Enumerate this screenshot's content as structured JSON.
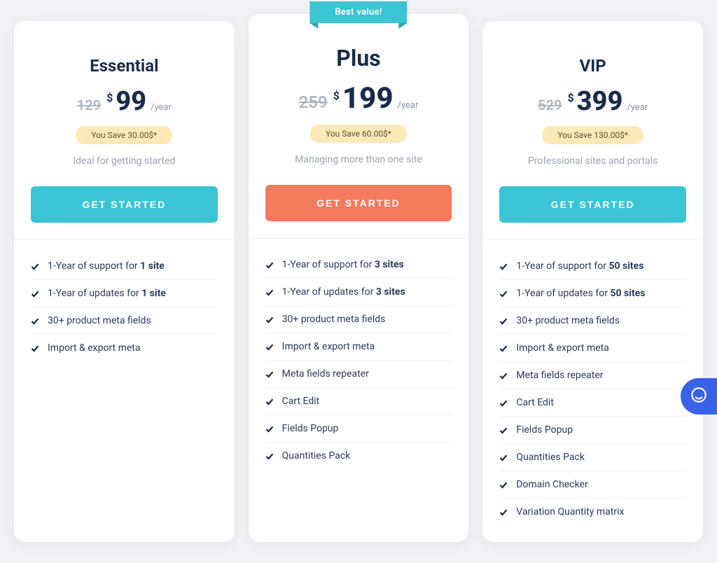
{
  "ribbon": "Best value!",
  "plans": [
    {
      "name": "Essential",
      "old_price": "129",
      "currency": "$",
      "price": "99",
      "period": "/year",
      "save": "You Save 30.00$*",
      "tagline": "Ideal for getting started",
      "cta": "GET STARTED",
      "features": [
        {
          "pre": "1-Year of support for ",
          "bold": "1 site",
          "post": ""
        },
        {
          "pre": "1-Year of updates for ",
          "bold": "1 site",
          "post": ""
        },
        {
          "pre": "30+ product meta fields",
          "bold": "",
          "post": ""
        },
        {
          "pre": "Import & export meta",
          "bold": "",
          "post": ""
        }
      ]
    },
    {
      "name": "Plus",
      "old_price": "259",
      "currency": "$",
      "price": "199",
      "period": "/year",
      "save": "You Save 60.00$*",
      "tagline": "Managing more than one site",
      "cta": "GET STARTED",
      "features": [
        {
          "pre": "1-Year of support for ",
          "bold": "3 sites",
          "post": ""
        },
        {
          "pre": "1-Year of updates for ",
          "bold": "3 sites",
          "post": ""
        },
        {
          "pre": "30+ product meta fields",
          "bold": "",
          "post": ""
        },
        {
          "pre": "Import & export meta",
          "bold": "",
          "post": ""
        },
        {
          "pre": "Meta fields repeater",
          "bold": "",
          "post": ""
        },
        {
          "pre": "Cart Edit",
          "bold": "",
          "post": ""
        },
        {
          "pre": "Fields Popup",
          "bold": "",
          "post": ""
        },
        {
          "pre": "Quantities Pack",
          "bold": "",
          "post": ""
        }
      ]
    },
    {
      "name": "VIP",
      "old_price": "529",
      "currency": "$",
      "price": "399",
      "period": "/year",
      "save": "You Save 130.00$*",
      "tagline": "Professional sites and portals",
      "cta": "GET STARTED",
      "features": [
        {
          "pre": "1-Year of support for ",
          "bold": "50 sites",
          "post": ""
        },
        {
          "pre": "1-Year of updates for ",
          "bold": "50 sites",
          "post": ""
        },
        {
          "pre": "30+ product meta fields",
          "bold": "",
          "post": ""
        },
        {
          "pre": "Import & export meta",
          "bold": "",
          "post": ""
        },
        {
          "pre": "Meta fields repeater",
          "bold": "",
          "post": ""
        },
        {
          "pre": "Cart Edit",
          "bold": "",
          "post": ""
        },
        {
          "pre": "Fields Popup",
          "bold": "",
          "post": ""
        },
        {
          "pre": "Quantities Pack",
          "bold": "",
          "post": ""
        },
        {
          "pre": "Domain Checker",
          "bold": "",
          "post": ""
        },
        {
          "pre": "Variation Quantity matrix",
          "bold": "",
          "post": ""
        }
      ]
    }
  ]
}
